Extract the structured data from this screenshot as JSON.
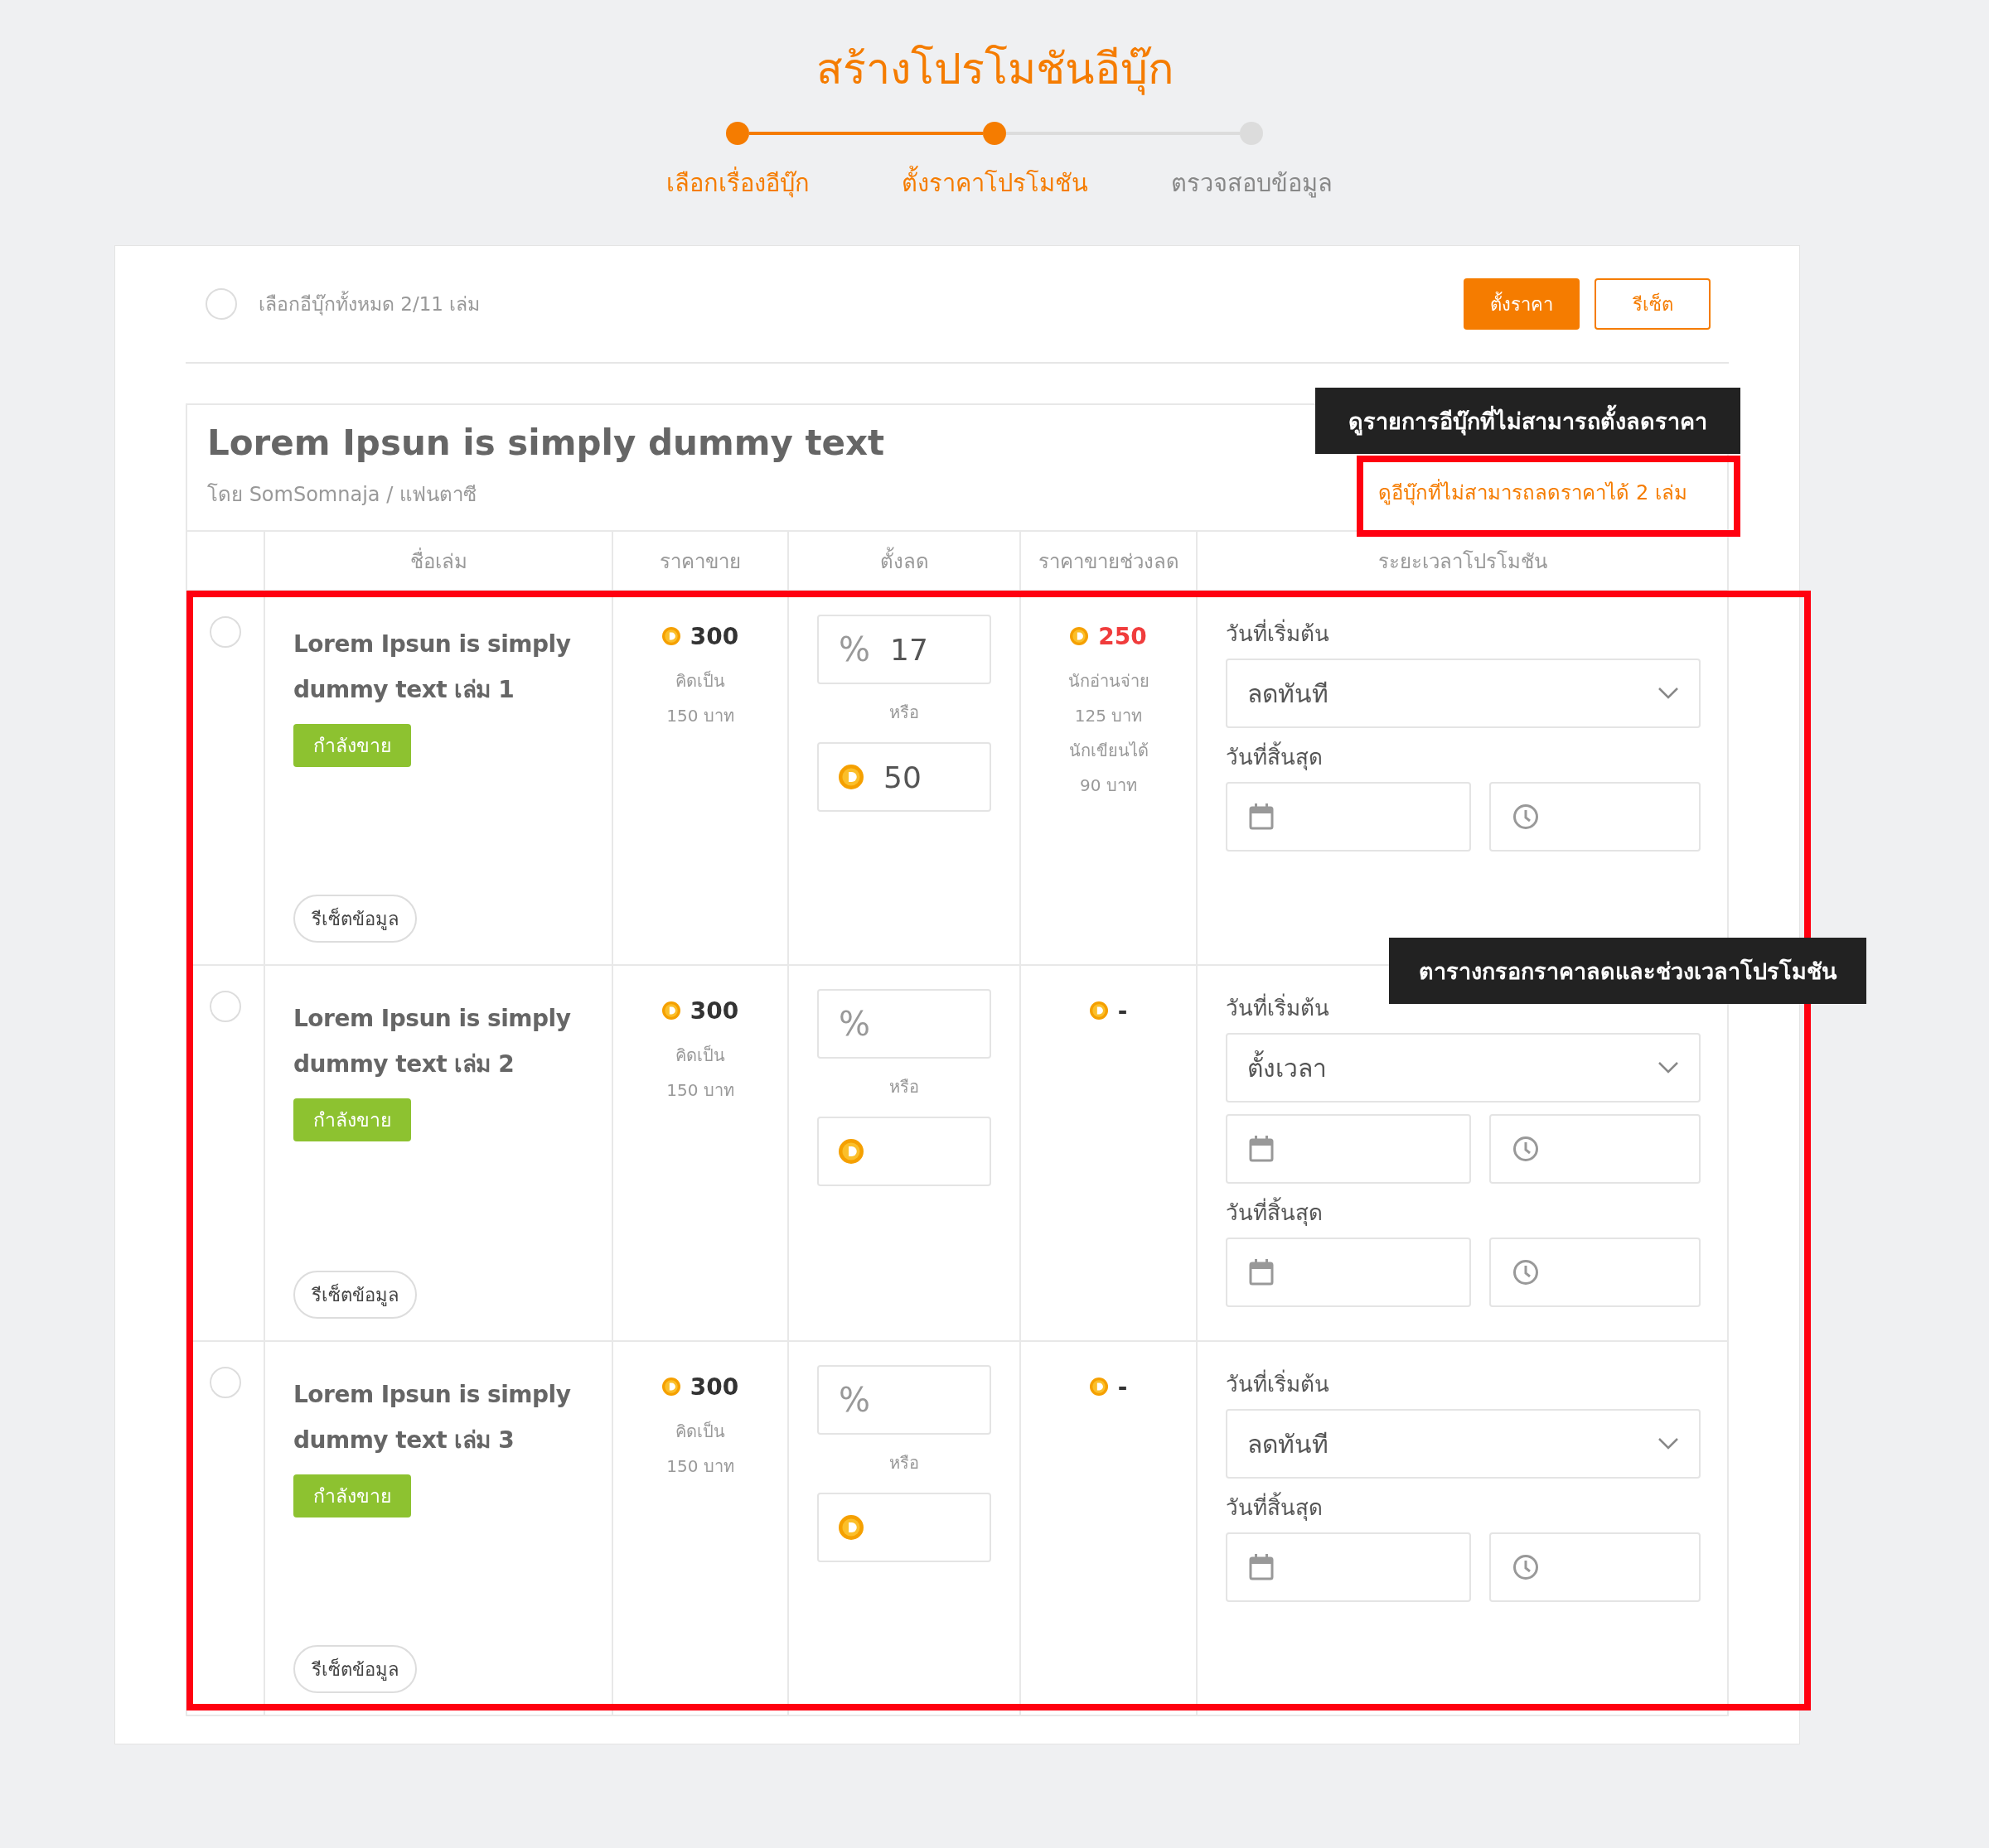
{
  "title": "สร้างโปรโมชันอีบุ๊ก",
  "steps": [
    {
      "label": "เลือกเรื่องอีบุ๊ก",
      "reached": true
    },
    {
      "label": "ตั้งราคาโปรโมชัน",
      "reached": true
    },
    {
      "label": "ตรวจสอบข้อมูล",
      "reached": false
    }
  ],
  "toolbar": {
    "select_all": {
      "label": "เลือกอีบุ๊กทั้งหมด 2/11 เล่ม",
      "checked": false
    },
    "buttons": [
      "ตั้งราคา",
      "รีเซ็ต"
    ]
  },
  "book": {
    "title": "Lorem Ipsun is simply dummy text",
    "byline": "โดย SomSomnaja / แฟนตาซี",
    "link": "ดูอีบุ๊กที่ไม่สามารถลดราคาได้ 2 เล่ม"
  },
  "table": {
    "columns": [
      "ชื่อเล่ม",
      "ราคาขาย",
      "ตั้งลด",
      "ราคาขายช่วงลด",
      "ระยะเวลาโปรโมชัน"
    ],
    "rows": [
      {
        "checked": false,
        "name": "Lorem Ipsun is simply dummy text เล่ม 1",
        "status": "กำลังขาย",
        "reset": "รีเซ็ตข้อมูล",
        "price": "300",
        "price_notes": [
          "คิดเป็น",
          "150 บาท"
        ],
        "percent_symbol": "%",
        "percent": "17",
        "or": "หรือ",
        "coins": "50",
        "sale_price": "250",
        "discounted": true,
        "sale_notes": [
          "นักอ่านจ่าย",
          "125 บาท",
          "นักเขียนได้",
          "90 บาท"
        ],
        "start_label": "วันที่เริ่มต้น",
        "schedule": "ลดทันที",
        "kind": "immediate",
        "end_label": "วันที่สิ้นสุด"
      },
      {
        "checked": false,
        "name": "Lorem Ipsun is simply dummy text เล่ม 2",
        "status": "กำลังขาย",
        "reset": "รีเซ็ตข้อมูล",
        "price": "300",
        "price_notes": [
          "คิดเป็น",
          "150 บาท"
        ],
        "percent_symbol": "%",
        "or": "หรือ",
        "sale_price": "-",
        "discounted": false,
        "start_label": "วันที่เริ่มต้น",
        "schedule": "ตั้งเวลา",
        "kind": "scheduled",
        "end_label": "วันที่สิ้นสุด"
      },
      {
        "checked": false,
        "name": "Lorem Ipsun is simply dummy text เล่ม 3",
        "status": "กำลังขาย",
        "reset": "รีเซ็ตข้อมูล",
        "price": "300",
        "price_notes": [
          "คิดเป็น",
          "150 บาท"
        ],
        "percent_symbol": "%",
        "or": "หรือ",
        "sale_price": "-",
        "discounted": false,
        "start_label": "วันที่เริ่มต้น",
        "schedule": "ลดทันที",
        "kind": "immediate",
        "end_label": "วันที่สิ้นสุด"
      }
    ]
  },
  "annotations": [
    {
      "text": "ดูรายการอีบุ๊กที่ไม่สามารถตั้งลดราคา",
      "kind": "link"
    },
    {
      "text": "ตารางกรอกราคาลดและช่วงเวลาโปรโมชัน",
      "kind": "rows"
    }
  ]
}
